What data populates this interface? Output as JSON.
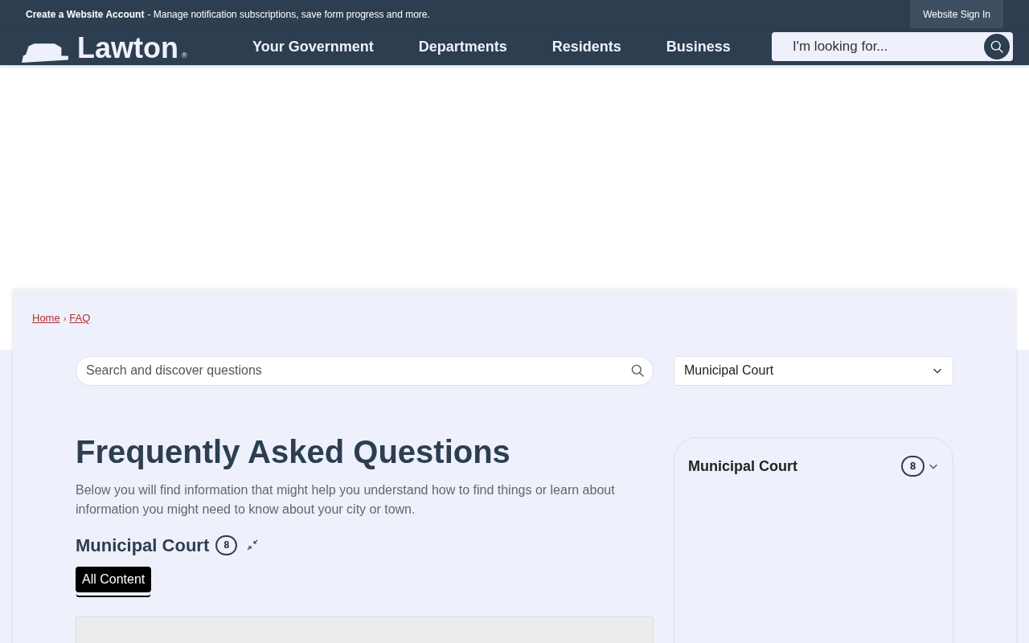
{
  "banner": {
    "title": "Create a Website Account",
    "text": "- Manage notification subscriptions, save form progress and more.",
    "sign_in": "Website Sign In"
  },
  "header": {
    "logo": "Lawton",
    "logo_mark": "®",
    "nav": [
      "Your Government",
      "Departments",
      "Residents",
      "Business"
    ],
    "search": {
      "placeholder": "I'm looking for..."
    }
  },
  "breadcrumb": [
    "Home",
    "FAQ"
  ],
  "breadcrumb_separator": "›",
  "faq_search": {
    "placeholder": "Search and discover questions"
  },
  "category_select": {
    "value": "Municipal Court"
  },
  "title": "Frequently Asked Questions",
  "intro": "Below you will find information that might help you understand how to find things or learn about information you might need to know about your city or town.",
  "section": {
    "title": "Municipal Court",
    "count": "8",
    "expanded": true
  },
  "tabs": [
    {
      "label": "All Content",
      "selected": true
    }
  ],
  "sidebar_card": {
    "title": "Municipal Court",
    "count": "8",
    "expanded": false
  }
}
